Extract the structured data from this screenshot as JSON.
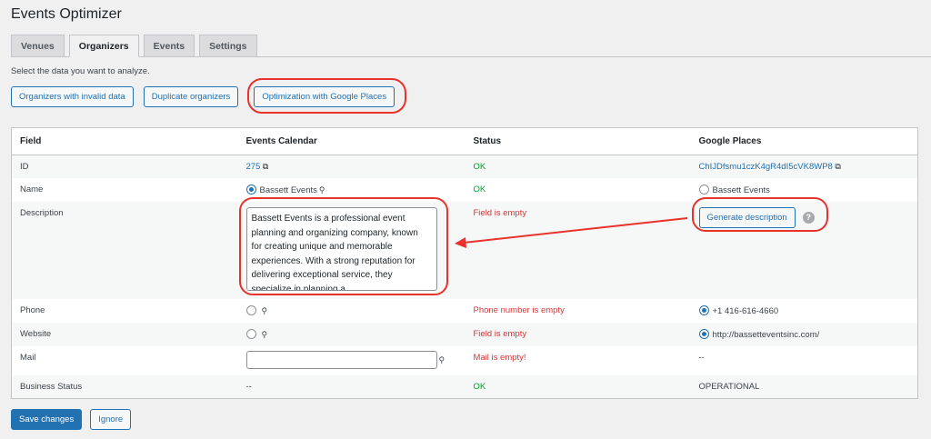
{
  "title": "Events Optimizer",
  "tabs": [
    {
      "label": "Venues"
    },
    {
      "label": "Organizers",
      "active": true
    },
    {
      "label": "Events"
    },
    {
      "label": "Settings"
    }
  ],
  "intro": "Select the data you want to analyze.",
  "analysis_buttons": [
    "Organizers with invalid data",
    "Duplicate organizers",
    "Optimization with Google Places"
  ],
  "table": {
    "headers": [
      "Field",
      "Events Calendar",
      "Status",
      "Google Places"
    ],
    "rows": {
      "id": {
        "field": "ID",
        "ec": "275",
        "status": "OK",
        "gp": "ChIJDfsmu1czK4gR4dI5cVK8WP8"
      },
      "name": {
        "field": "Name",
        "ec": "Bassett Events",
        "status": "OK",
        "gp": "Bassett Events"
      },
      "description": {
        "field": "Description",
        "ec": "Bassett Events is a professional event planning and organizing company, known for creating unique and memorable experiences. With a strong reputation for delivering exceptional service, they specialize in planning a",
        "status": "Field is empty",
        "gp_button": "Generate description",
        "help": "?"
      },
      "phone": {
        "field": "Phone",
        "status": "Phone number is empty",
        "gp": "+1 416-616-4660"
      },
      "website": {
        "field": "Website",
        "status": "Field is empty",
        "gp": "http://bassetteventsinc.com/"
      },
      "mail": {
        "field": "Mail",
        "ec": "",
        "status": "Mail is empty!",
        "gp": "--"
      },
      "business_status": {
        "field": "Business Status",
        "ec": "--",
        "status": "OK",
        "gp": "OPERATIONAL"
      }
    }
  },
  "footer": {
    "save": "Save changes",
    "ignore": "Ignore"
  },
  "colors": {
    "accent": "#2271b1",
    "ok": "#00a32a",
    "error": "#d63638",
    "annotation": "#e8322b"
  }
}
